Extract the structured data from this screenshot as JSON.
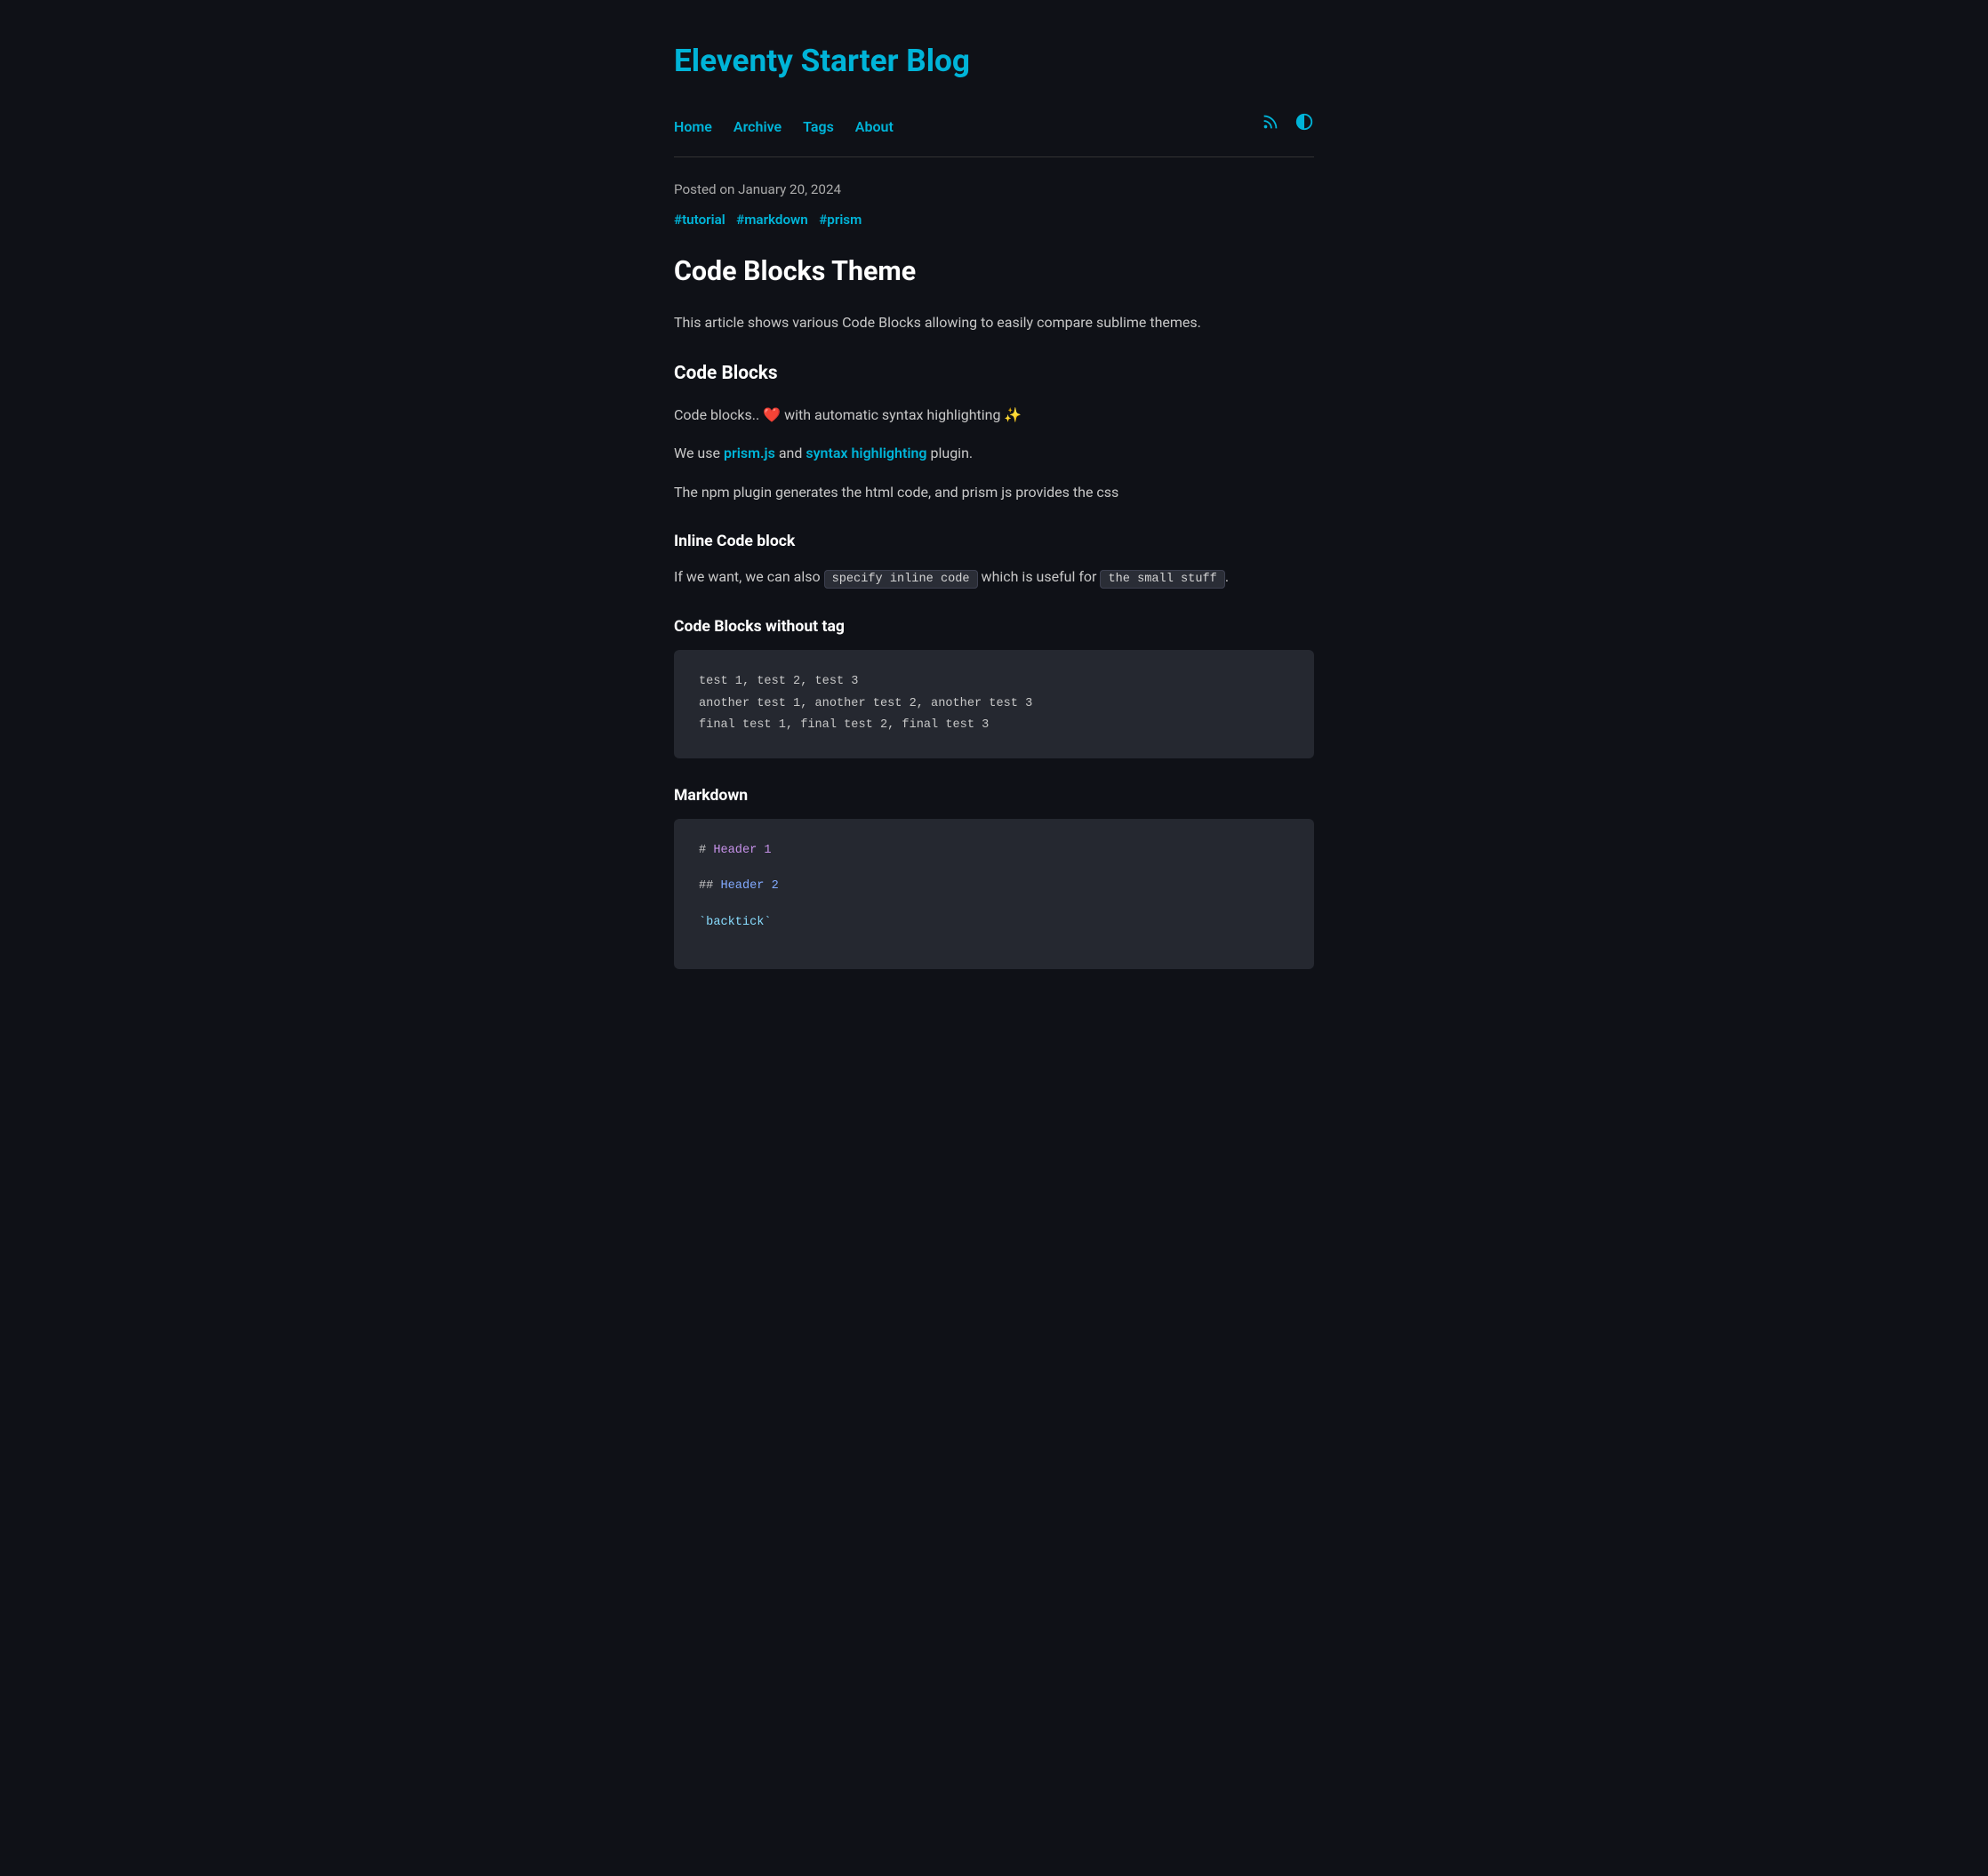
{
  "site": {
    "title": "Eleventy Starter Blog"
  },
  "nav": {
    "links": [
      {
        "label": "Home",
        "href": "#"
      },
      {
        "label": "Archive",
        "href": "#"
      },
      {
        "label": "Tags",
        "href": "#"
      },
      {
        "label": "About",
        "href": "#"
      }
    ],
    "rss_icon": "⊞",
    "theme_icon": "◑"
  },
  "post": {
    "date": "Posted on January 20, 2024",
    "tags": [
      "#tutorial",
      "#markdown",
      "#prism"
    ],
    "title": "Code Blocks Theme",
    "intro": "This article shows various Code Blocks allowing to easily compare sublime themes.",
    "sections": [
      {
        "heading": "Code Blocks",
        "paragraphs": [
          {
            "text_parts": [
              {
                "type": "text",
                "value": "Code blocks.. "
              },
              {
                "type": "emoji",
                "value": "❤️"
              },
              {
                "type": "text",
                "value": " with automatic syntax highlighting "
              },
              {
                "type": "emoji",
                "value": "✨"
              }
            ]
          },
          {
            "text_parts": [
              {
                "type": "text",
                "value": "We use "
              },
              {
                "type": "link",
                "value": "prism.js"
              },
              {
                "type": "text",
                "value": " and "
              },
              {
                "type": "link",
                "value": "syntax highlighting"
              },
              {
                "type": "text",
                "value": " plugin."
              }
            ]
          },
          {
            "text_parts": [
              {
                "type": "text",
                "value": "The npm plugin generates the html code, and prism js provides the css"
              }
            ]
          }
        ]
      },
      {
        "sub_heading": "Inline Code block",
        "inline_text_before": "If we want, we can also ",
        "inline_code_1": "specify inline code",
        "inline_text_middle": " which is useful for ",
        "inline_code_2": "the small stuff",
        "inline_text_after": "."
      },
      {
        "sub_heading": "Code Blocks without tag",
        "code_block": [
          "test 1, test 2, test 3",
          "another test 1, another test 2, another test 3",
          "final test 1, final test 2, final test 3"
        ]
      },
      {
        "sub_heading": "Markdown",
        "markdown_code": true
      }
    ]
  }
}
